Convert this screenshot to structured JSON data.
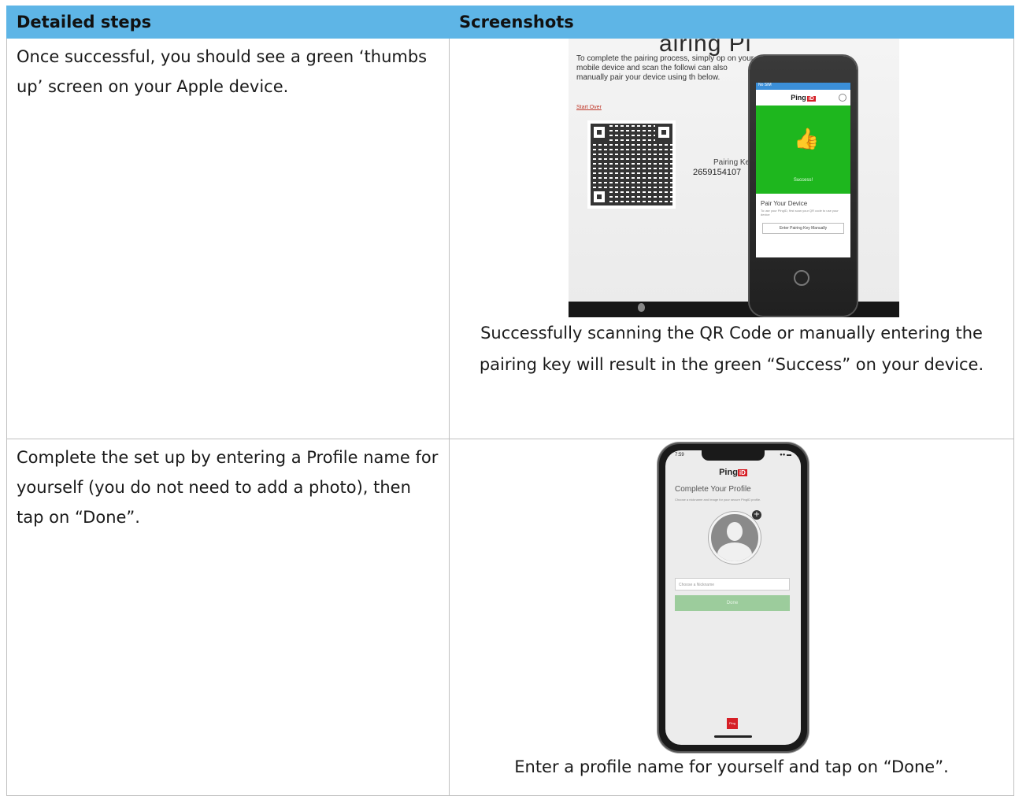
{
  "table": {
    "headers": {
      "steps": "Detailed steps",
      "screenshots": "Screenshots"
    },
    "rows": [
      {
        "step": "Once successful, you should see a green ‘thumbs up’ screen on your Apple device.",
        "caption": "Successfully scanning the QR Code or manually entering the pairing key will result in the green “Success” on your device."
      },
      {
        "step": "Complete the set up by entering a Profile name for yourself (you do not need to add a photo), then tap on “Done”.",
        "caption": "Enter a profile name for yourself and tap on “Done”."
      }
    ]
  },
  "screenshot1": {
    "title": "airing Pi",
    "instructions": "To complete the pairing process, simply op on your mobile device and scan the followi can also manually pair your device using th below.",
    "start_over": "Start Over",
    "pairing_key_label": "Pairing Key",
    "pairing_key_value": "2659154107",
    "phone": {
      "status": "No SIM",
      "brand": "Ping",
      "brand_badge": "iD",
      "success": "Success!",
      "pair_title": "Pair Your Device",
      "pair_desc": "To use your PingID, first scan your QR code to use your device",
      "manual_button": "Enter Pairing Key Manually"
    }
  },
  "screenshot2": {
    "time": "7:59",
    "brand": "Ping",
    "brand_badge": "iD",
    "title": "Complete Your Profile",
    "subtitle": "Choose a nickname and image for your secure PingID profile.",
    "nickname_placeholder": "Choose a Nickname",
    "done_label": "Done",
    "footer_logo": "Ping"
  }
}
